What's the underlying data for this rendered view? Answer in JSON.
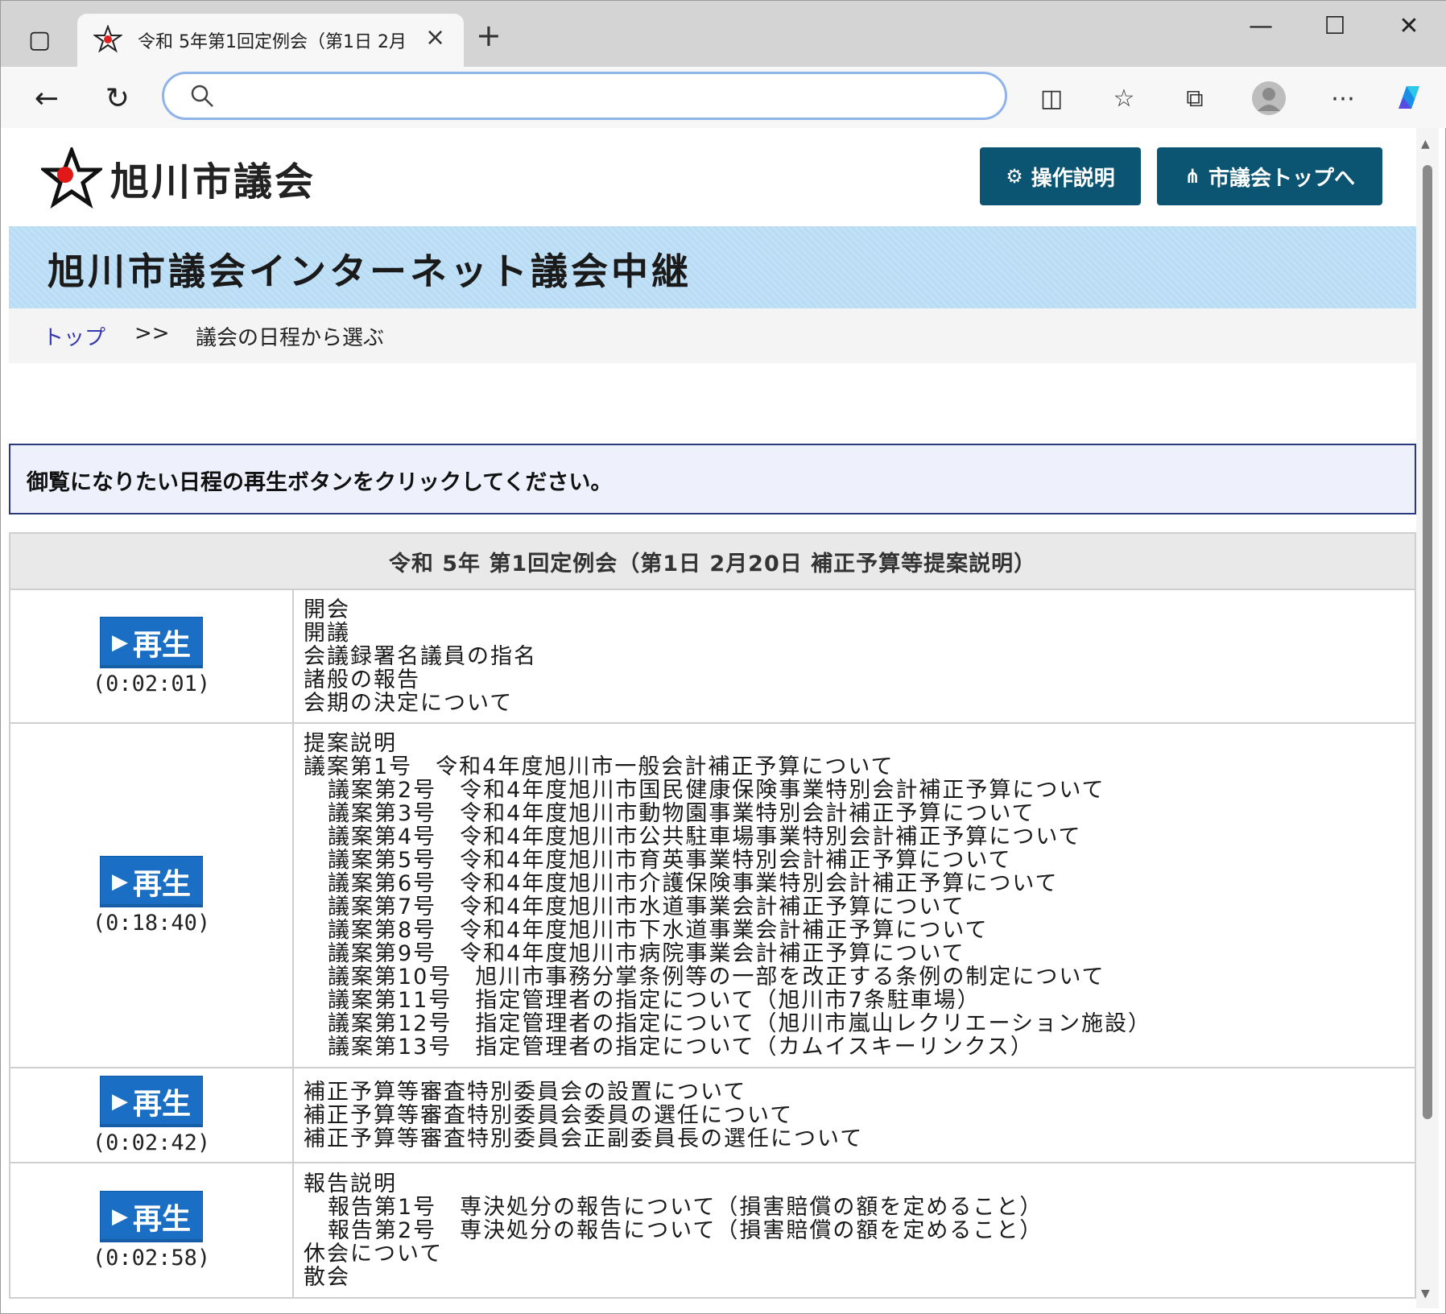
{
  "browser": {
    "tab_title": "令和 5年第1回定例会（第1日 2月",
    "new_tab_label": "+"
  },
  "site": {
    "logo_text": "旭川市議会",
    "help_button": "操作説明",
    "top_button": "市議会トップへ",
    "banner_title": "旭川市議会インターネット議会中継"
  },
  "breadcrumb": {
    "top": "トップ",
    "separator": ">>",
    "current": "議会の日程から選ぶ"
  },
  "notice": "御覧になりたい日程の再生ボタンをクリックしてください。",
  "schedule": {
    "header": "令和 5年 第1回定例会（第1日 2月20日 補正予算等提案説明）",
    "play_label": "再生",
    "rows": [
      {
        "duration": "(0:02:01)",
        "lines": [
          {
            "text": "開会",
            "indent": false
          },
          {
            "text": "開議",
            "indent": false
          },
          {
            "text": "会議録署名議員の指名",
            "indent": false
          },
          {
            "text": "諸般の報告",
            "indent": false
          },
          {
            "text": "会期の決定について",
            "indent": false
          }
        ]
      },
      {
        "duration": "(0:18:40)",
        "lines": [
          {
            "text": "提案説明",
            "indent": false
          },
          {
            "text": "議案第1号　令和4年度旭川市一般会計補正予算について",
            "indent": false
          },
          {
            "text": "議案第2号　令和4年度旭川市国民健康保険事業特別会計補正予算について",
            "indent": true
          },
          {
            "text": "議案第3号　令和4年度旭川市動物園事業特別会計補正予算について",
            "indent": true
          },
          {
            "text": "議案第4号　令和4年度旭川市公共駐車場事業特別会計補正予算について",
            "indent": true
          },
          {
            "text": "議案第5号　令和4年度旭川市育英事業特別会計補正予算について",
            "indent": true
          },
          {
            "text": "議案第6号　令和4年度旭川市介護保険事業特別会計補正予算について",
            "indent": true
          },
          {
            "text": "議案第7号　令和4年度旭川市水道事業会計補正予算について",
            "indent": true
          },
          {
            "text": "議案第8号　令和4年度旭川市下水道事業会計補正予算について",
            "indent": true
          },
          {
            "text": "議案第9号　令和4年度旭川市病院事業会計補正予算について",
            "indent": true
          },
          {
            "text": "議案第10号　旭川市事務分掌条例等の一部を改正する条例の制定について",
            "indent": true
          },
          {
            "text": "議案第11号　指定管理者の指定について（旭川市7条駐車場）",
            "indent": true
          },
          {
            "text": "議案第12号　指定管理者の指定について（旭川市嵐山レクリエーション施設）",
            "indent": true
          },
          {
            "text": "議案第13号　指定管理者の指定について（カムイスキーリンクス）",
            "indent": true
          }
        ]
      },
      {
        "duration": "(0:02:42)",
        "lines": [
          {
            "text": "補正予算等審査特別委員会の設置について",
            "indent": false
          },
          {
            "text": "補正予算等審査特別委員会委員の選任について",
            "indent": false
          },
          {
            "text": "補正予算等審査特別委員会正副委員長の選任について",
            "indent": false
          }
        ]
      },
      {
        "duration": "(0:02:58)",
        "lines": [
          {
            "text": "報告説明",
            "indent": false
          },
          {
            "text": "報告第1号　専決処分の報告について（損害賠償の額を定めること）",
            "indent": true
          },
          {
            "text": "報告第2号　専決処分の報告について（損害賠償の額を定めること）",
            "indent": true
          },
          {
            "text": "休会について",
            "indent": false
          },
          {
            "text": "散会",
            "indent": false
          }
        ]
      }
    ]
  },
  "colors": {
    "header_button": "#0c5572",
    "play_button": "#1a6fc4",
    "banner": "#b9dcf5"
  }
}
